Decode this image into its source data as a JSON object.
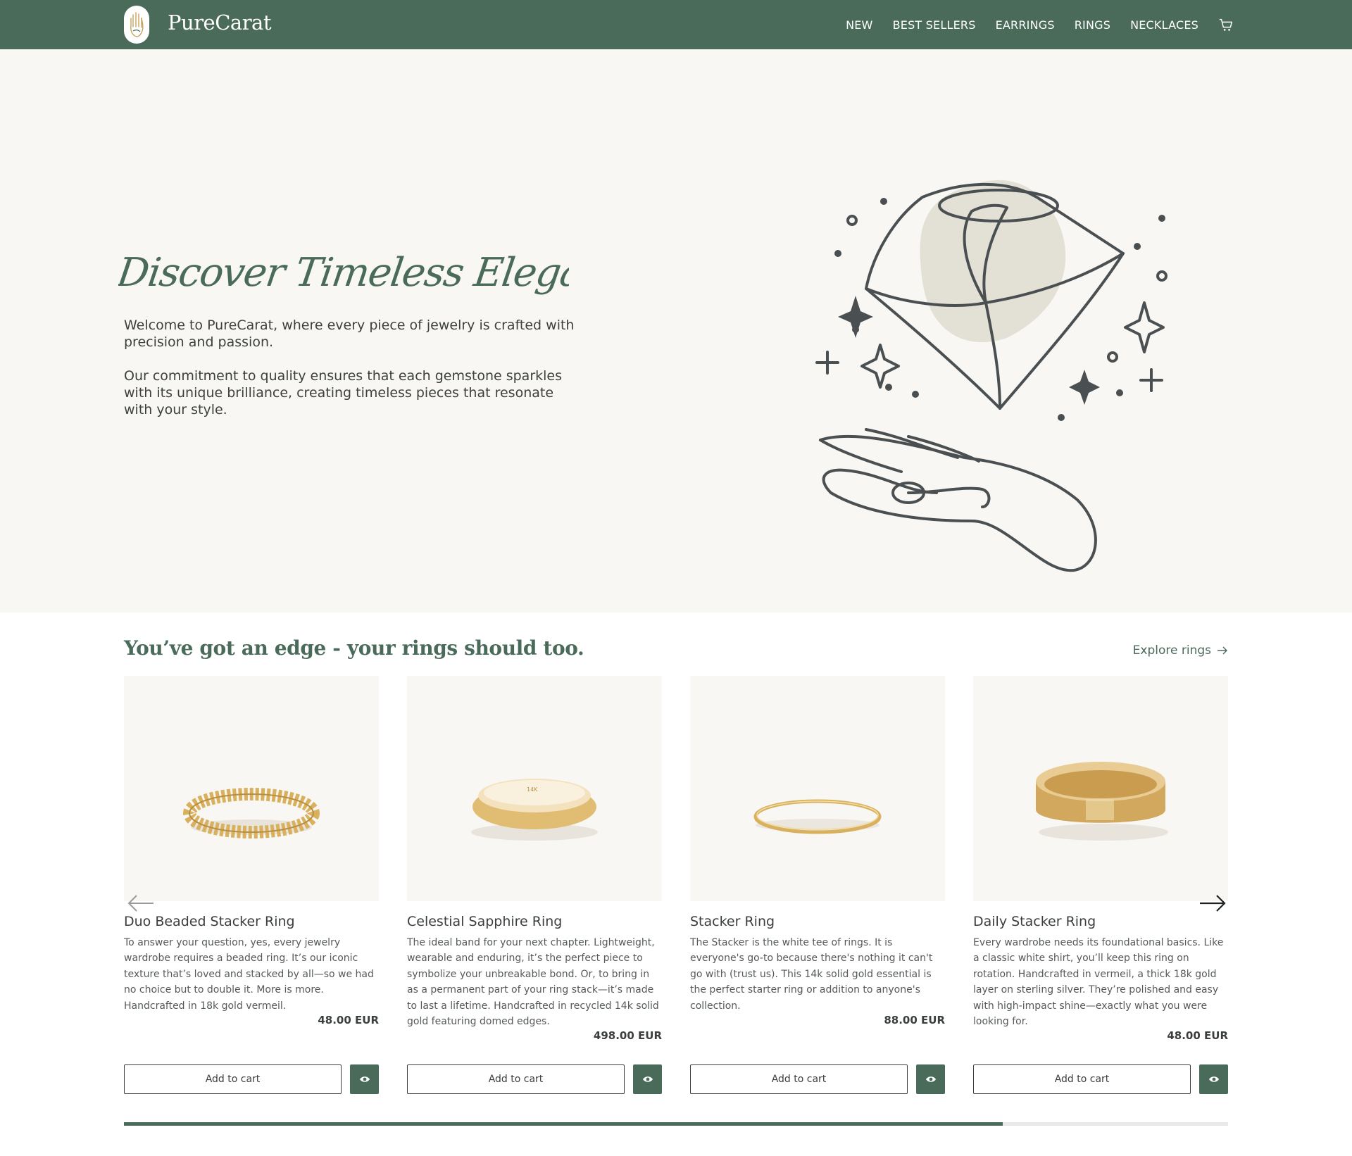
{
  "header": {
    "brand": "PureCarat",
    "nav": [
      "NEW",
      "BEST SELLERS",
      "EARRINGS",
      "RINGS",
      "NECKLACES"
    ]
  },
  "hero": {
    "title": "Discover Timeless Elegance",
    "paragraph1": "Welcome to PureCarat, where every piece of jewelry is crafted with precision and passion.",
    "paragraph2": "Our commitment to quality ensures that each gemstone sparkles with its unique brilliance, creating timeless pieces that resonate with your style."
  },
  "section": {
    "title": "You’ve got an edge - your rings should too.",
    "explore_label": "Explore rings"
  },
  "products": [
    {
      "name": "Duo Beaded Stacker Ring",
      "description": "To answer your question, yes, every jewelry wardrobe requires a beaded ring. It’s our iconic texture that’s loved and stacked by all—so we had no choice but to double it. More is more. Handcrafted in 18k gold vermeil.",
      "price": "48.00 EUR",
      "add_label": "Add to cart"
    },
    {
      "name": "Celestial Sapphire Ring",
      "description": "The ideal band for your next chapter. Lightweight, wearable and enduring, it’s the perfect piece to symbolize your unbreakable bond. Or, to bring in as a permanent part of your ring stack—it’s made to last a lifetime. Handcrafted in recycled 14k solid gold featuring domed edges.",
      "price": "498.00 EUR",
      "add_label": "Add to cart"
    },
    {
      "name": "Stacker Ring",
      "description": "The Stacker is the white tee of rings. It is everyone's go-to because there's nothing it can't go with (trust us). This 14k solid gold essential is the perfect starter ring or addition to anyone's collection.",
      "price": "88.00 EUR",
      "add_label": "Add to cart"
    },
    {
      "name": "Daily Stacker Ring",
      "description": "Every wardrobe needs its foundational basics. Like a classic white shirt, you’ll keep this ring on rotation. Handcrafted in vermeil, a thick 18k gold layer on sterling silver. They’re polished and easy with high-impact shine—exactly what you were looking for.",
      "price": "48.00 EUR",
      "add_label": "Add to cart"
    }
  ],
  "carousel": {
    "progress": 0.796
  },
  "colors": {
    "brand_green": "#4a6b5a",
    "hero_bg": "#f9f7f3",
    "gold": "#d9b15e"
  },
  "icons": [
    "cart-icon",
    "eye-icon",
    "arrow-left-icon",
    "arrow-right-icon",
    "arrow-right-small-icon",
    "hand-logo-icon"
  ]
}
